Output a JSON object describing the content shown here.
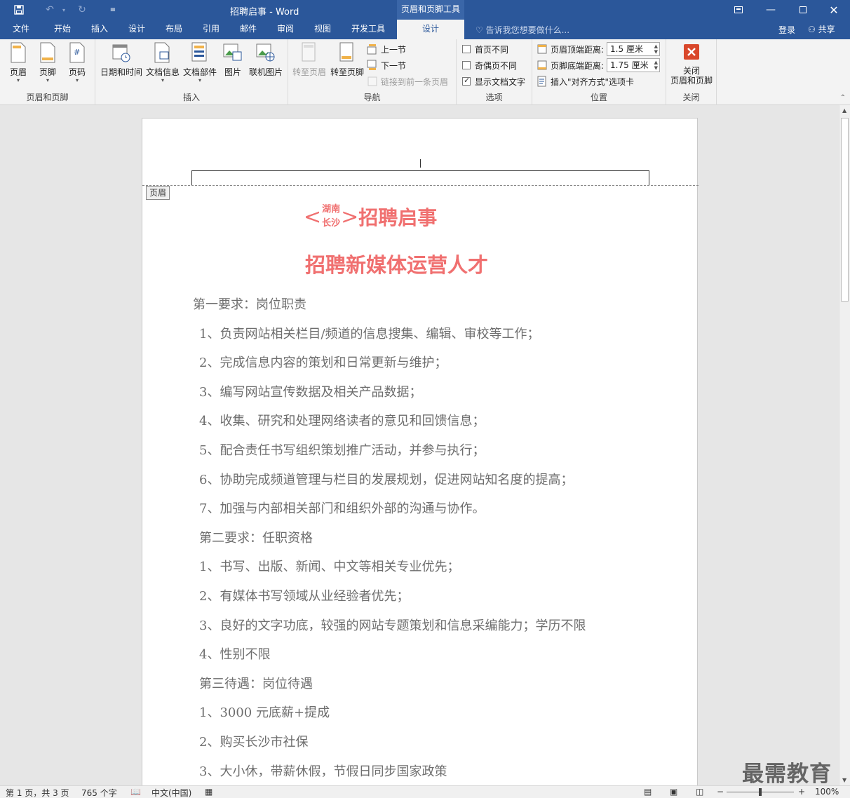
{
  "window": {
    "title": "招聘启事 - Word",
    "context_tool_title": "页眉和页脚工具",
    "colors": {
      "accent": "#2b579a",
      "title_red": "#f07070"
    }
  },
  "tabs": [
    "文件",
    "开始",
    "插入",
    "设计",
    "布局",
    "引用",
    "邮件",
    "审阅",
    "视图",
    "开发工具",
    "设计"
  ],
  "tell_me": "告诉我您想要做什么...",
  "sign_in": "登录",
  "share": "共享",
  "ribbon": {
    "groups": {
      "header_footer": {
        "label": "页眉和页脚",
        "buttons": [
          "页眉",
          "页脚",
          "页码"
        ]
      },
      "insert": {
        "label": "插入",
        "buttons": [
          "日期和时间",
          "文档信息",
          "文档部件",
          "图片",
          "联机图片"
        ]
      },
      "navigation": {
        "label": "导航",
        "goto_header": "转至页眉",
        "goto_footer": "转至页脚",
        "prev_section": "上一节",
        "next_section": "下一节",
        "link_previous": "链接到前一条页眉"
      },
      "options": {
        "label": "选项",
        "first_page_diff": "首页不同",
        "odd_even_diff": "奇偶页不同",
        "show_doc_text": "显示文档文字"
      },
      "position": {
        "label": "位置",
        "header_top_label": "页眉顶端距离:",
        "header_top_value": "1.5 厘米",
        "footer_bottom_label": "页脚底端距离:",
        "footer_bottom_value": "1.75 厘米",
        "insert_align_tab": "插入\"对齐方式\"选项卡"
      },
      "close": {
        "label": "关闭",
        "button_line1": "关闭",
        "button_line2": "页眉和页脚"
      }
    }
  },
  "document": {
    "header_tag": "页眉",
    "title_left_bracket": "<",
    "title_small_top": "湖南",
    "title_small_bottom": "长沙",
    "title_right_bracket": ">",
    "title_main": "招聘启事",
    "subtitle": "招聘新媒体运营人才",
    "lines": [
      "第一要求：岗位职责",
      "1、负责网站相关栏目/频道的信息搜集、编辑、审校等工作；",
      "2、完成信息内容的策划和日常更新与维护；",
      "3、编写网站宣传数据及相关产品数据；",
      "4、收集、研究和处理网络读者的意见和回馈信息；",
      "5、配合责任书写组织策划推广活动，并参与执行；",
      "6、协助完成频道管理与栏目的发展规划，促进网站知名度的提高；",
      "7、加强与内部相关部门和组织外部的沟通与协作。",
      "第二要求：任职资格",
      "1、书写、出版、新闻、中文等相关专业优先；",
      "2、有媒体书写领域从业经验者优先；",
      "3、良好的文字功底，较强的网站专题策划和信息采编能力；学历不限",
      "4、性别不限",
      "第三待遇：岗位待遇",
      "1、3000 元底薪+提成",
      "2、购买长沙市社保",
      "3、大小休，带薪休假，节假日同步国家政策"
    ]
  },
  "status": {
    "page": "第 1 页，共 3 页",
    "words": "765 个字",
    "language": "中文(中国)",
    "zoom": "100%"
  },
  "watermark": "最需教育"
}
